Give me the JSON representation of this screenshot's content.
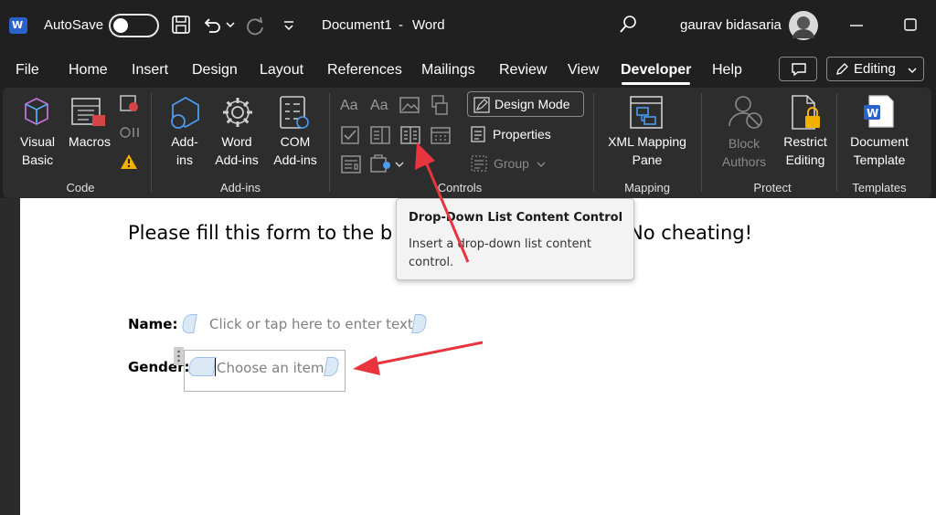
{
  "titlebar": {
    "autosave_label": "AutoSave",
    "document_title": "Document1",
    "separator": "-",
    "app_name": "Word",
    "user_name": "gaurav bidasaria"
  },
  "tabs": [
    {
      "label": "File"
    },
    {
      "label": "Home"
    },
    {
      "label": "Insert"
    },
    {
      "label": "Design"
    },
    {
      "label": "Layout"
    },
    {
      "label": "References"
    },
    {
      "label": "Mailings"
    },
    {
      "label": "Review"
    },
    {
      "label": "View"
    },
    {
      "label": "Developer",
      "active": true
    },
    {
      "label": "Help"
    }
  ],
  "editing_label": "Editing",
  "ribbon": {
    "code": {
      "group_label": "Code",
      "visual_basic": [
        "Visual",
        "Basic"
      ],
      "macros": "Macros"
    },
    "addins": {
      "group_label": "Add-ins",
      "addins": [
        "Add-",
        "ins"
      ],
      "word_addins": [
        "Word",
        "Add-ins"
      ],
      "com_addins": [
        "COM",
        "Add-ins"
      ]
    },
    "controls": {
      "group_label": "Controls",
      "rich_text": "Aa",
      "plain_text": "Aa",
      "design_mode": "Design Mode",
      "properties": "Properties",
      "group": "Group"
    },
    "mapping": {
      "group_label": "Mapping",
      "xml_mapping": [
        "XML Mapping",
        "Pane"
      ]
    },
    "protect": {
      "group_label": "Protect",
      "block_authors": [
        "Block",
        "Authors"
      ],
      "restrict_editing": [
        "Restrict",
        "Editing"
      ]
    },
    "templates": {
      "group_label": "Templates",
      "document_template": [
        "Document",
        "Template"
      ]
    }
  },
  "tooltip": {
    "title": "Drop-Down List Content Control",
    "description": "Insert a drop-down list content control."
  },
  "document": {
    "heading_start": "Please fill this form to the b",
    "heading_end": "No cheating!",
    "name_label": "Name:",
    "name_placeholder": "Click or tap here to enter text.",
    "gender_label": "Gender:",
    "gender_placeholder": "Choose an item."
  },
  "colors": {
    "titlebar_bg": "#202020",
    "ribbon_bg": "#2d2d2d",
    "word_blue": "#2b62c9",
    "annotation_red": "#e8353d",
    "placeholder_gray": "#808080"
  }
}
